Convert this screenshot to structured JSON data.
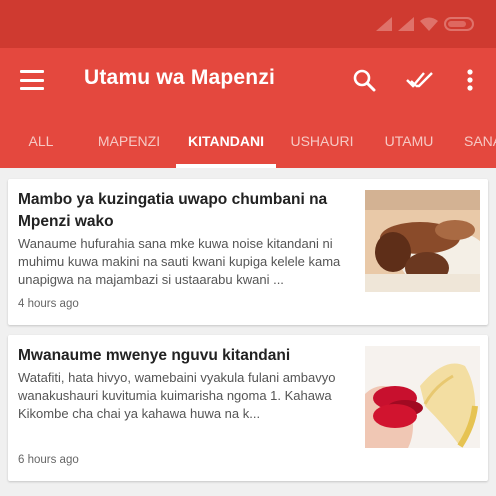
{
  "app": {
    "title": "Utamu wa Mapenzi",
    "status_bar": {
      "battery_icon": "battery-icon",
      "signal_icon": "signal-icon",
      "wifi_icon": "wifi-icon"
    },
    "actions": [
      {
        "name": "search",
        "icon": "search-icon"
      },
      {
        "name": "mark-all-read",
        "icon": "double-check-icon"
      },
      {
        "name": "more-options",
        "icon": "more-vert-icon"
      }
    ],
    "colors": {
      "status_bar": "#cf3a30",
      "app_bar": "#e4483e",
      "tab_inactive": "#f6c9c4",
      "tab_active": "#ffffff",
      "background": "#f0f0f0"
    }
  },
  "tabs": [
    {
      "label": "ALL",
      "active": false
    },
    {
      "label": "MAPENZI",
      "active": false
    },
    {
      "label": "KITANDANI",
      "active": true
    },
    {
      "label": "USHAURI",
      "active": false
    },
    {
      "label": "UTAMU",
      "active": false
    },
    {
      "label": "SANA",
      "active": false
    }
  ],
  "articles": [
    {
      "title": "Mambo ya kuzingatia uwapo chumbani na Mpenzi wako",
      "snippet": "Wanaume hufurahia sana mke kuwa noise kitandani ni muhimu kuwa makini na sauti kwani kupiga kelele kama unapigwa na majambazi si ustaarabu kwani ...",
      "time": "4 hours ago",
      "image": "couple-bed-photo"
    },
    {
      "title": "Mwanaume mwenye nguvu kitandani",
      "snippet": "Watafiti, hata hivyo, wamebaini vyakula fulani ambavyo wanakushauri kuvitumia kuimarisha ngoma 1. Kahawa Kikombe cha chai ya kahawa huwa na k...",
      "time": "6 hours ago",
      "image": "lips-banana-photo"
    }
  ]
}
